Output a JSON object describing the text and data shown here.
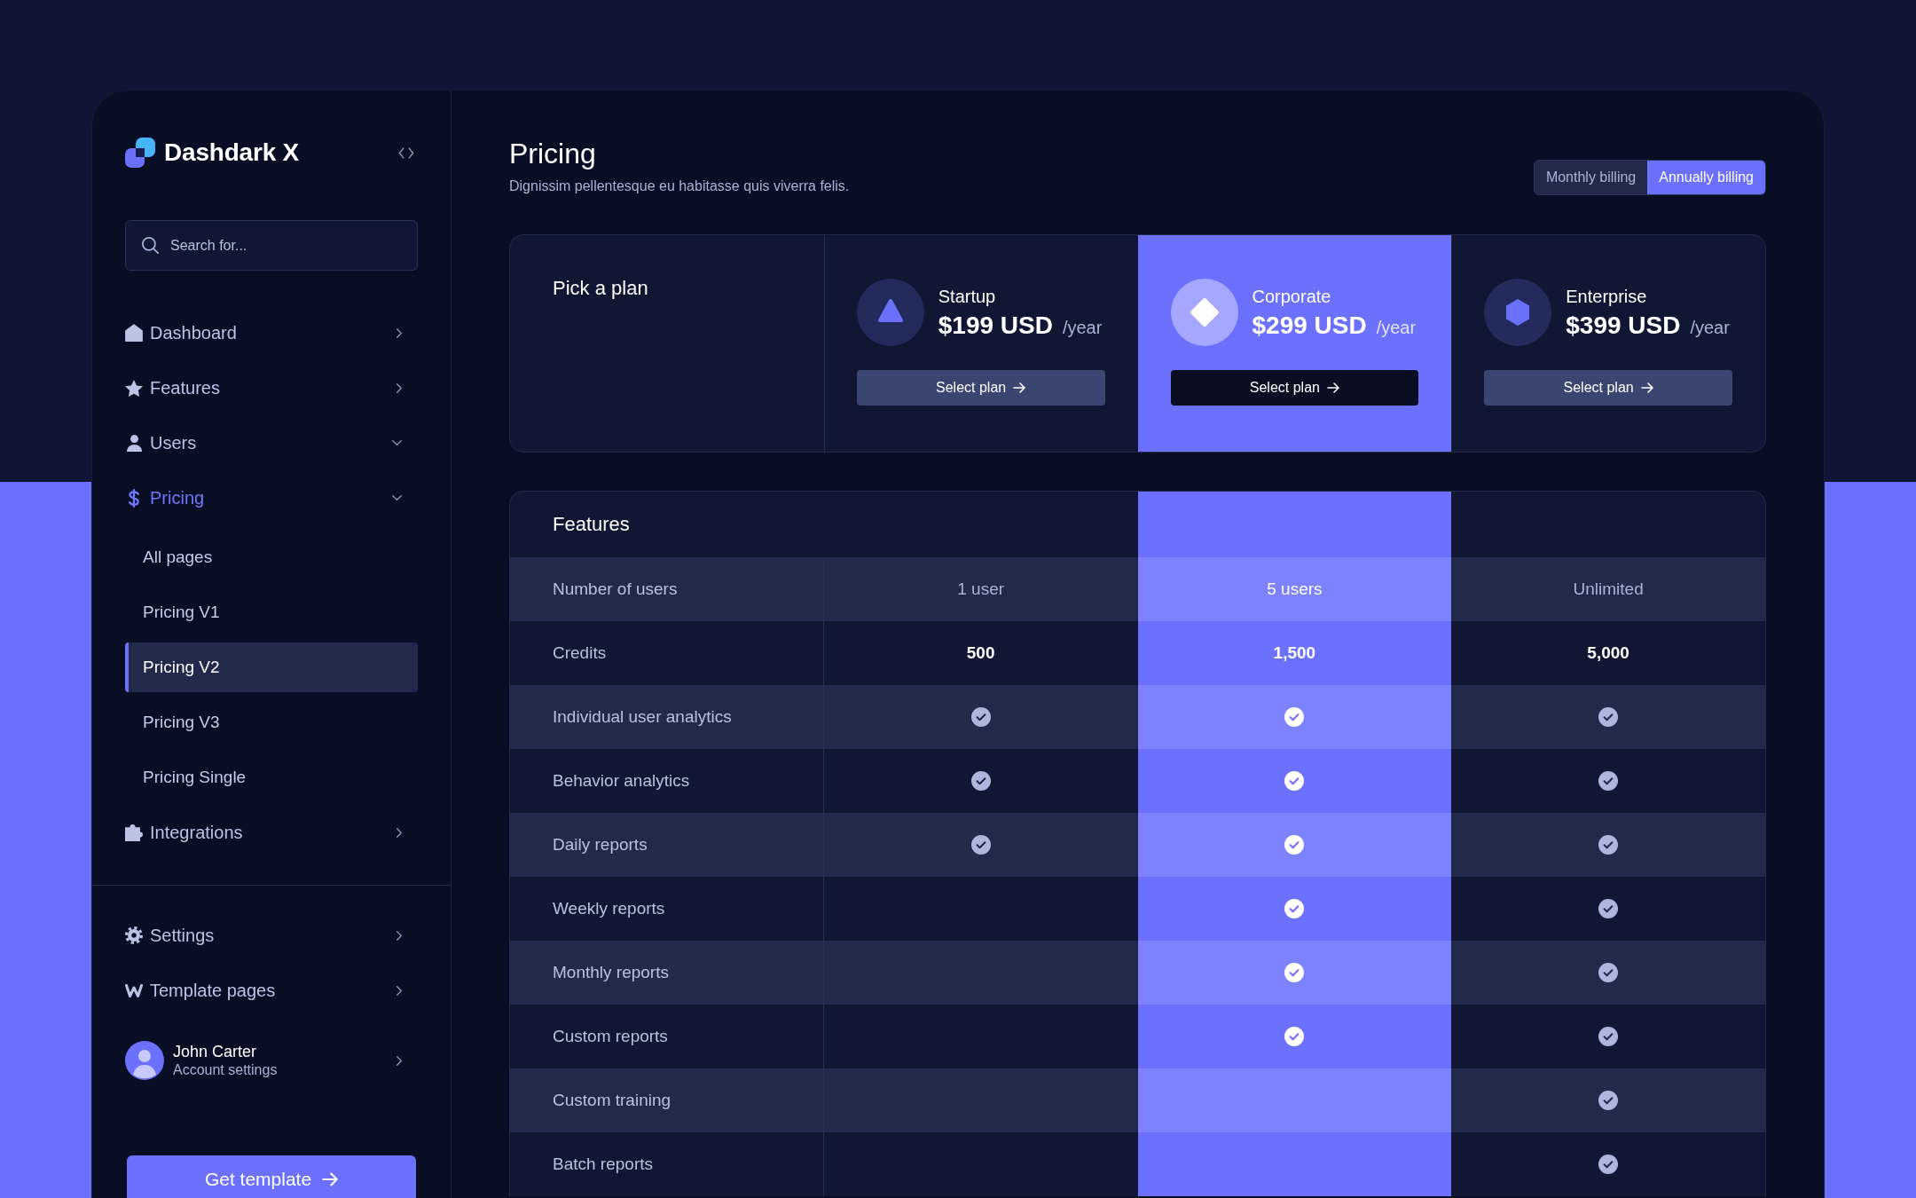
{
  "sidebar": {
    "brand": "Dashdark X",
    "search": {
      "placeholder": "Search for..."
    },
    "items": [
      {
        "label": "Dashboard",
        "kind": "link",
        "selected": false
      },
      {
        "label": "Features",
        "kind": "link",
        "selected": false
      },
      {
        "label": "Users",
        "kind": "dropdown",
        "selected": false
      },
      {
        "label": "Pricing",
        "kind": "dropdown",
        "selected": true,
        "children": [
          {
            "label": "All pages",
            "selected": false
          },
          {
            "label": "Pricing V1",
            "selected": false
          },
          {
            "label": "Pricing V2",
            "selected": true
          },
          {
            "label": "Pricing V3",
            "selected": false
          },
          {
            "label": "Pricing Single",
            "selected": false
          }
        ]
      },
      {
        "label": "Integrations",
        "kind": "link",
        "selected": false
      }
    ],
    "footer_items": [
      {
        "label": "Settings",
        "kind": "link",
        "selected": false
      },
      {
        "label": "Template pages",
        "kind": "link",
        "selected": false
      }
    ],
    "profile": {
      "name": "John Carter",
      "subtitle": "Account settings"
    },
    "cta": "Get template"
  },
  "header": {
    "title": "Pricing",
    "subtitle": "Dignissim pellentesque eu habitasse quis viverra felis.",
    "billing": [
      {
        "label": "Monthly billing",
        "selected": false
      },
      {
        "label": "Annually billing",
        "selected": true
      }
    ]
  },
  "plans": {
    "heading": "Pick a plan",
    "items": [
      {
        "name": "Startup",
        "price": "$199 USD",
        "period": "/year",
        "button": "Select plan",
        "selected": false
      },
      {
        "name": "Corporate",
        "price": "$299 USD",
        "period": "/year",
        "button": "Select plan",
        "selected": true
      },
      {
        "name": "Enterprise",
        "price": "$399 USD",
        "period": "/year",
        "button": "Select plan",
        "selected": false
      }
    ]
  },
  "features": {
    "title": "Features",
    "rows": [
      {
        "label": "Number of users",
        "kind": "text",
        "values": [
          "1 user",
          "5 users",
          "Unlimited"
        ]
      },
      {
        "label": "Credits",
        "kind": "number",
        "values": [
          "500",
          "1,500",
          "5,000"
        ]
      },
      {
        "label": "Individual user analytics",
        "kind": "check",
        "included": [
          true,
          true,
          true
        ]
      },
      {
        "label": "Behavior analytics",
        "kind": "check",
        "included": [
          true,
          true,
          true
        ]
      },
      {
        "label": "Daily reports",
        "kind": "check",
        "included": [
          true,
          true,
          true
        ]
      },
      {
        "label": "Weekly reports",
        "kind": "check",
        "included": [
          false,
          true,
          true
        ]
      },
      {
        "label": "Monthly reports",
        "kind": "check",
        "included": [
          false,
          true,
          true
        ]
      },
      {
        "label": "Custom reports",
        "kind": "check",
        "included": [
          false,
          true,
          true
        ]
      },
      {
        "label": "Custom training",
        "kind": "check",
        "included": [
          false,
          false,
          true
        ]
      },
      {
        "label": "Batch reports",
        "kind": "check",
        "included": [
          false,
          false,
          true
        ]
      }
    ]
  }
}
